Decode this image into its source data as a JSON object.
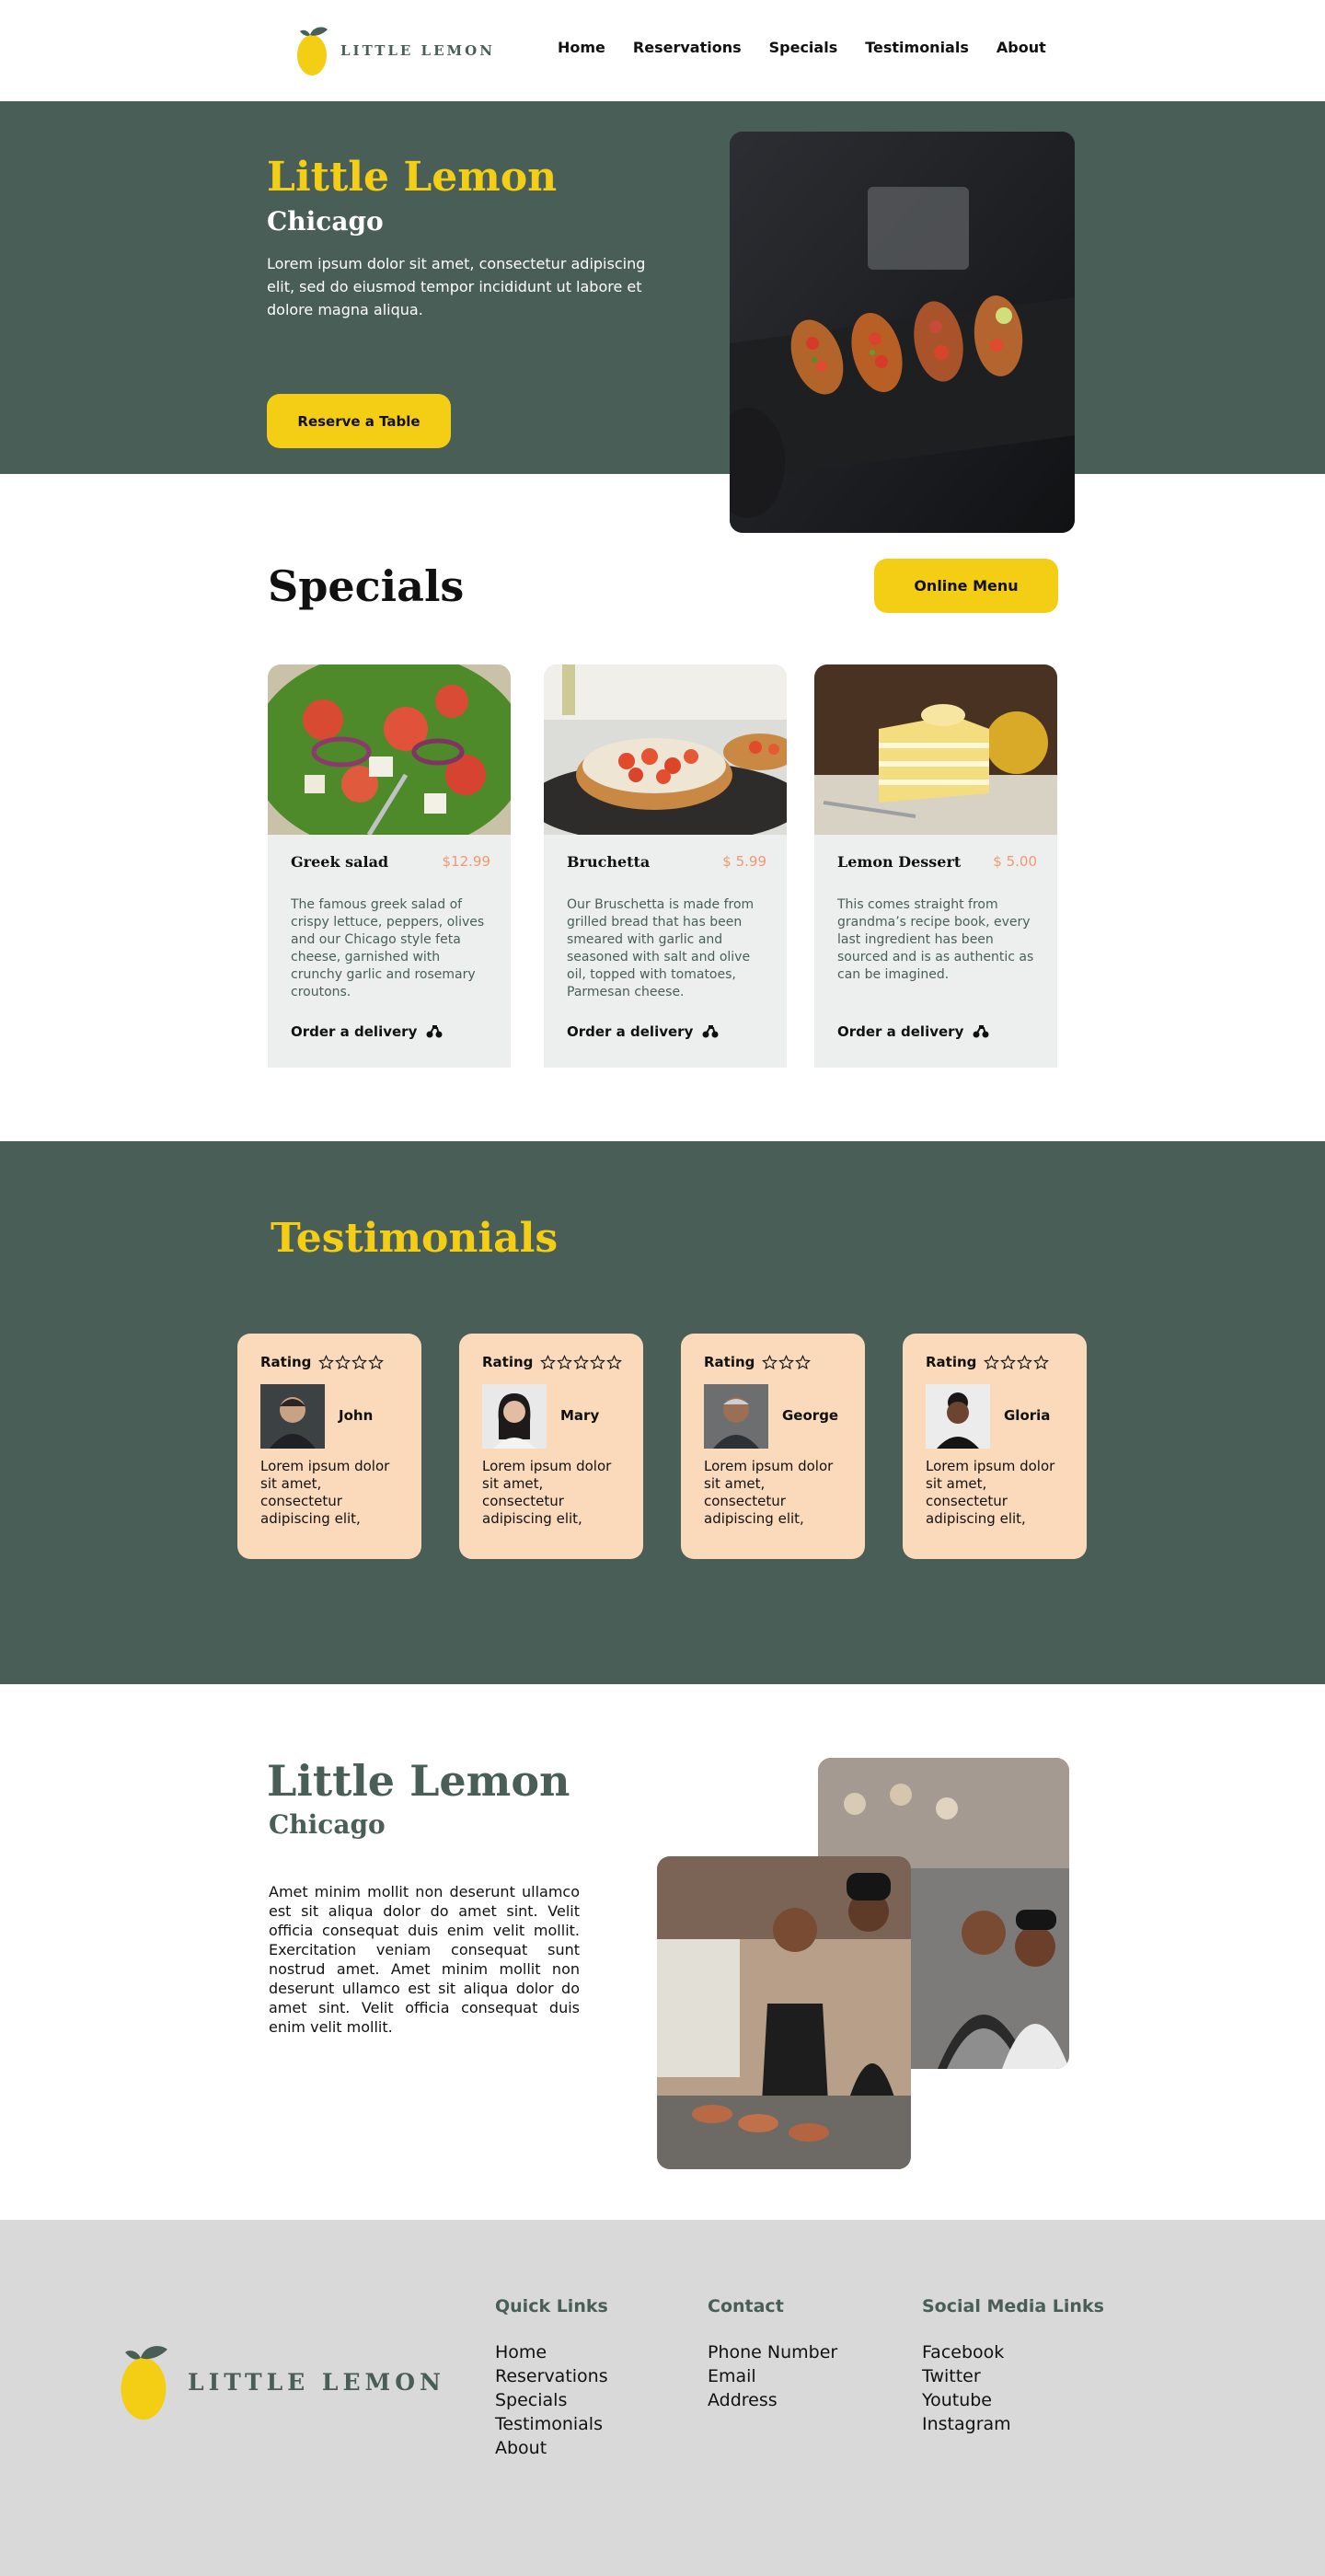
{
  "brand": {
    "name": "LITTLE LEMON",
    "colors": {
      "primary_green": "#495e57",
      "primary_yellow": "#f4ce14",
      "accent_peach": "#fbdabb",
      "accent_salmon": "#ee9972",
      "highlight": "#edefee"
    }
  },
  "nav": {
    "logo_alt": "Little Lemon logo",
    "links": [
      "Home",
      "Reservations",
      "Specials",
      "Testimonials",
      "About"
    ]
  },
  "hero": {
    "title": "Little Lemon",
    "subtitle": "Chicago",
    "description": "Lorem ipsum dolor sit amet, consectetur adipiscing elit, sed do eiusmod tempor incididunt ut labore et dolore magna aliqua.",
    "cta_label": "Reserve a Table",
    "image": "bruschetta-platter-photo"
  },
  "specials": {
    "title": "Specials",
    "menu_button_label": "Online Menu",
    "items": [
      {
        "name": "Greek salad",
        "price": "$12.99",
        "description": "The famous greek salad of crispy lettuce, peppers, olives and our Chicago style feta cheese, garnished with crunchy garlic and rosemary croutons.",
        "order_label": "Order a delivery",
        "image": "greek-salad-photo",
        "icon": "delivery-bike-icon"
      },
      {
        "name": "Bruchetta",
        "price": "$ 5.99",
        "description": "Our Bruschetta is made from grilled bread that has been smeared with garlic and seasoned with salt and olive oil, topped with tomatoes, Parmesan cheese.",
        "order_label": "Order a delivery",
        "image": "bruschetta-photo",
        "icon": "delivery-bike-icon"
      },
      {
        "name": "Lemon Dessert",
        "price": "$ 5.00",
        "description": "This comes straight from grandma’s recipe book, every last ingredient has been sourced and is as authentic as can be imagined.",
        "order_label": "Order a delivery",
        "image": "lemon-dessert-photo",
        "icon": "delivery-bike-icon"
      }
    ]
  },
  "testimonials": {
    "title": "Testimonials",
    "rating_label": "Rating",
    "items": [
      {
        "name": "John",
        "text": "Lorem ipsum dolor sit amet, consectetur adipiscing elit,",
        "stars": 4,
        "star_slots": 4
      },
      {
        "name": "Mary",
        "text": "Lorem ipsum dolor sit amet, consectetur adipiscing elit,",
        "stars": 5,
        "star_slots": 5
      },
      {
        "name": "George",
        "text": "Lorem ipsum dolor sit amet, consectetur adipiscing elit,",
        "stars": 3,
        "star_slots": 3
      },
      {
        "name": "Gloria",
        "text": "Lorem ipsum dolor sit amet, consectetur adipiscing elit,",
        "stars": 4,
        "star_slots": 4
      }
    ]
  },
  "about": {
    "title": "Little Lemon",
    "subtitle": "Chicago",
    "text": "Amet minim mollit non deserunt ullamco est sit aliqua dolor do amet sint. Velit officia consequat duis enim velit mollit. Exercitation veniam consequat sunt nostrud amet. Amet minim mollit non deserunt ullamco est sit aliqua dolor do amet sint. Velit officia consequat duis enim velit mollit.",
    "images": [
      "chefs-laughing-photo",
      "chefs-kitchen-photo"
    ]
  },
  "footer": {
    "logo_text": "LITTLE LEMON",
    "columns": [
      {
        "title": "Quick Links",
        "links": [
          "Home",
          "Reservations",
          "Specials",
          "Testimonials",
          "About"
        ]
      },
      {
        "title": "Contact",
        "links": [
          "Phone Number",
          "Email",
          "Address"
        ]
      },
      {
        "title": "Social Media Links",
        "links": [
          "Facebook",
          "Twitter",
          "Youtube",
          "Instagram"
        ]
      }
    ]
  }
}
